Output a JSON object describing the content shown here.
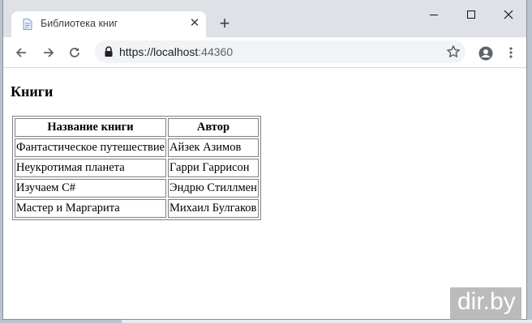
{
  "browser": {
    "tab_title": "Библиотека книг",
    "url_prefix": "https://localhost",
    "url_port": ":44360"
  },
  "icons": {
    "favicon": "document-icon",
    "tab_close": "close-icon",
    "new_tab": "plus-icon",
    "minimize": "minimize-icon",
    "maximize": "maximize-icon",
    "close": "close-icon",
    "back": "arrow-left-icon",
    "forward": "arrow-right-icon",
    "reload": "reload-icon",
    "lock": "lock-icon",
    "bookmark": "star-icon",
    "account": "account-icon",
    "menu": "kebab-menu-icon"
  },
  "page": {
    "heading": "Книги",
    "table": {
      "headers": [
        "Название книги",
        "Автор"
      ],
      "rows": [
        [
          "Фантастическое путешествие",
          "Айзек Азимов"
        ],
        [
          "Неукротимая планета",
          "Гарри Гаррисон"
        ],
        [
          "Изучаем C#",
          "Эндрю Стиллмен"
        ],
        [
          "Мастер и Маргарита",
          "Михаил Булгаков"
        ]
      ]
    }
  },
  "watermark": "dir.by",
  "colors": {
    "tabstrip": "#dee1e6",
    "omnibox": "#f1f3f4",
    "icon": "#5f6368"
  }
}
